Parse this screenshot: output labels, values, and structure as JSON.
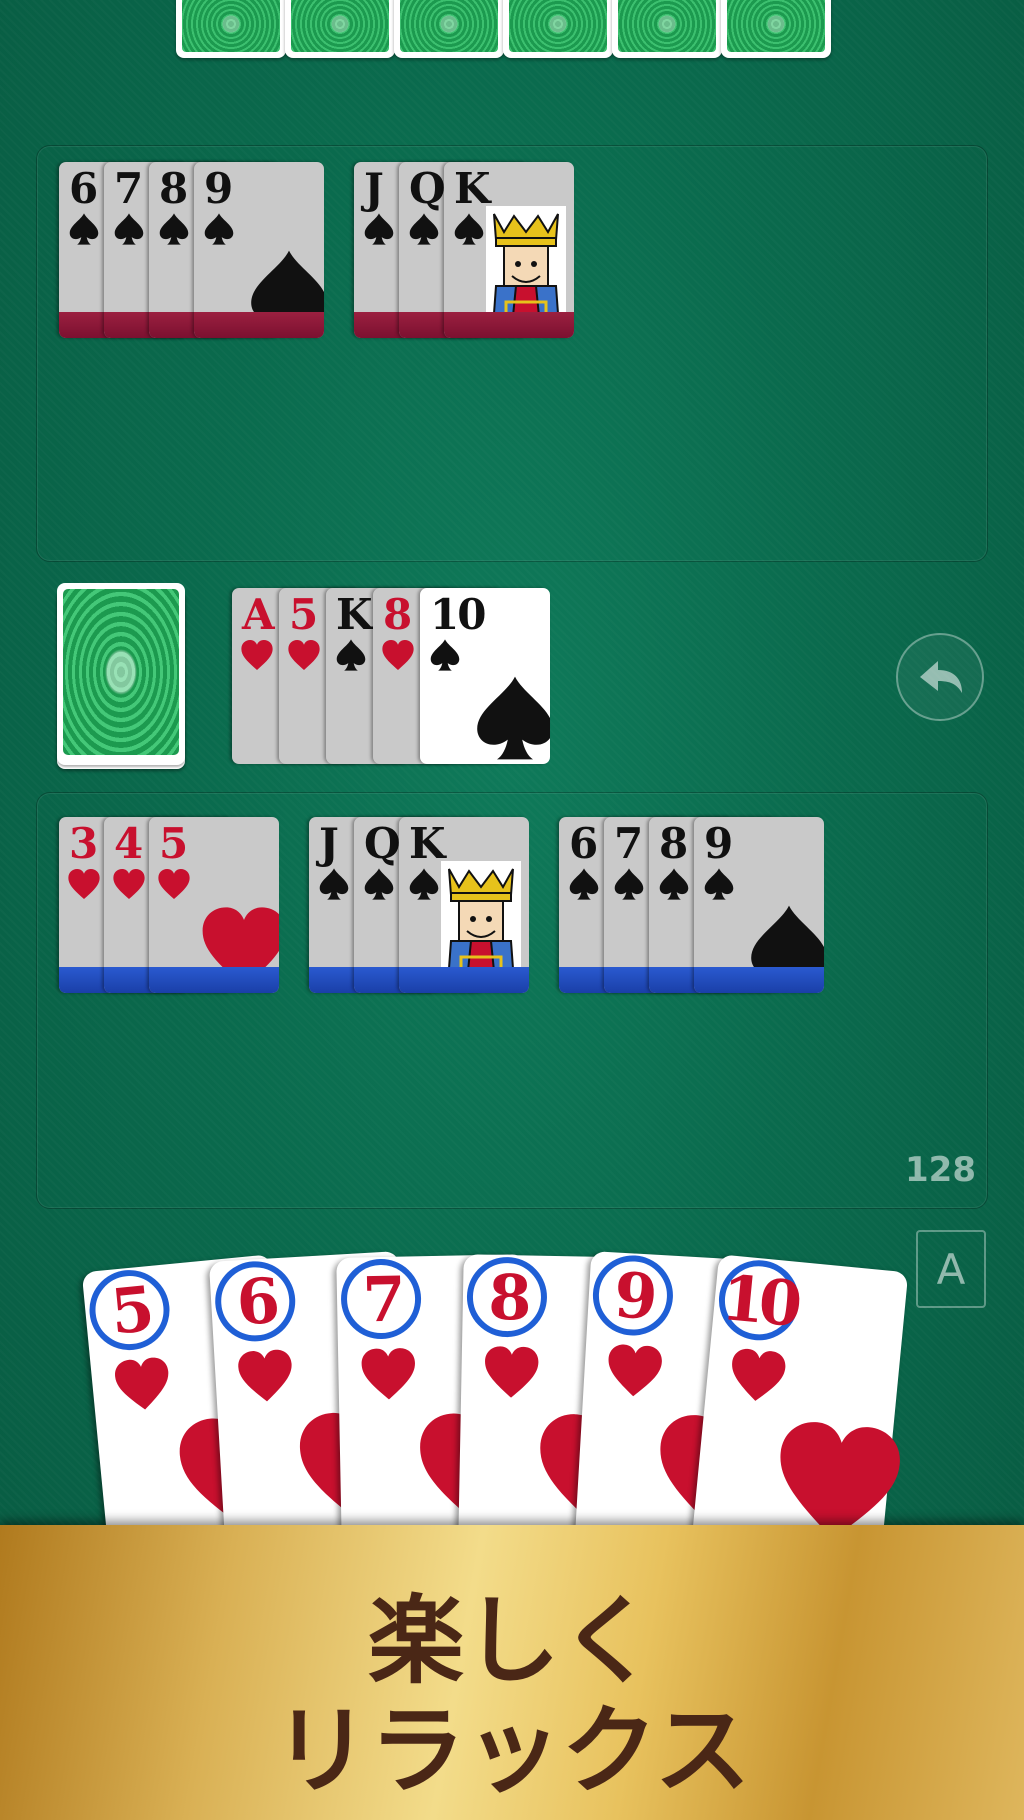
{
  "opponent": {
    "melds": [
      {
        "cards": [
          {
            "rank": "6",
            "suit": "spade"
          },
          {
            "rank": "7",
            "suit": "spade"
          },
          {
            "rank": "8",
            "suit": "spade"
          },
          {
            "rank": "9",
            "suit": "spade"
          }
        ]
      },
      {
        "cards": [
          {
            "rank": "J",
            "suit": "spade"
          },
          {
            "rank": "Q",
            "suit": "spade"
          },
          {
            "rank": "K",
            "suit": "spade"
          }
        ]
      }
    ]
  },
  "discard": {
    "cards": [
      {
        "rank": "A",
        "suit": "heart"
      },
      {
        "rank": "5",
        "suit": "heart"
      },
      {
        "rank": "K",
        "suit": "spade"
      },
      {
        "rank": "8",
        "suit": "heart"
      },
      {
        "rank": "10",
        "suit": "spade"
      }
    ]
  },
  "player": {
    "melds": [
      {
        "cards": [
          {
            "rank": "3",
            "suit": "heart"
          },
          {
            "rank": "4",
            "suit": "heart"
          },
          {
            "rank": "5",
            "suit": "heart"
          }
        ]
      },
      {
        "cards": [
          {
            "rank": "J",
            "suit": "spade"
          },
          {
            "rank": "Q",
            "suit": "spade"
          },
          {
            "rank": "K",
            "suit": "spade"
          }
        ]
      },
      {
        "cards": [
          {
            "rank": "6",
            "suit": "spade"
          },
          {
            "rank": "7",
            "suit": "spade"
          },
          {
            "rank": "8",
            "suit": "spade"
          },
          {
            "rank": "9",
            "suit": "spade"
          }
        ]
      }
    ],
    "score": "128",
    "hand": [
      {
        "rank": "5",
        "suit": "heart"
      },
      {
        "rank": "6",
        "suit": "heart"
      },
      {
        "rank": "7",
        "suit": "heart"
      },
      {
        "rank": "8",
        "suit": "heart"
      },
      {
        "rank": "9",
        "suit": "heart"
      },
      {
        "rank": "10",
        "suit": "heart"
      }
    ]
  },
  "controls": {
    "undo_icon": "undo-arrow-icon",
    "auto_button_label": "A"
  },
  "banner": {
    "line1": "楽しく",
    "line2": "リラックス"
  },
  "colors": {
    "felt": "#0a6a4d",
    "heart": "#c8102e",
    "spade": "#111111",
    "opponent_band": "#8a1838",
    "player_band": "#1f4fc0",
    "hand_circle": "#1f5fd6",
    "banner_text": "#4a2716"
  }
}
